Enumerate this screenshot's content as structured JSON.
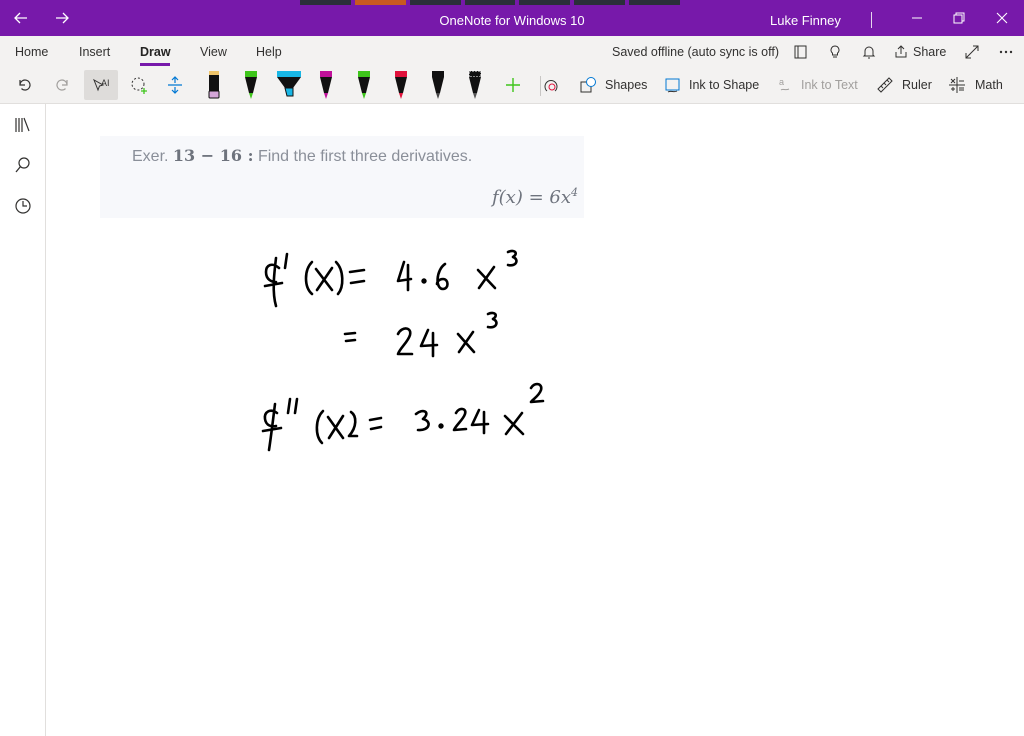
{
  "window": {
    "title": "OneNote for Windows 10",
    "user": "Luke Finney",
    "back_icon": "arrow-left-icon",
    "forward_icon": "arrow-right-icon",
    "accent": "#7719aa"
  },
  "menu": {
    "tabs": [
      "Home",
      "Insert",
      "Draw",
      "View",
      "Help"
    ],
    "active_tab": "Draw",
    "status": "Saved offline (auto sync is off)",
    "share_label": "Share"
  },
  "toolbar": {
    "shapes_label": "Shapes",
    "ink_to_shape_label": "Ink to Shape",
    "ink_to_text_label": "Ink to Text",
    "ruler_label": "Ruler",
    "math_label": "Math",
    "pens": [
      {
        "name": "black-marker",
        "color": "#111111"
      },
      {
        "name": "green-pen",
        "color": "#3ec51b"
      },
      {
        "name": "cyan-highlighter",
        "color": "#18b6e5"
      },
      {
        "name": "magenta-pen",
        "color": "#c0109a"
      },
      {
        "name": "green-pen-2",
        "color": "#3ec51b"
      },
      {
        "name": "red-pen",
        "color": "#e0123c"
      },
      {
        "name": "black-pen",
        "color": "#111111"
      },
      {
        "name": "black-pencil",
        "color": "#111111"
      }
    ]
  },
  "page": {
    "exercise_prefix": "Exer.",
    "exercise_range": "13 − 16 :",
    "exercise_instruction": "Find the first three derivatives.",
    "function_base": "f(x) = 6x",
    "function_exp": "4"
  }
}
